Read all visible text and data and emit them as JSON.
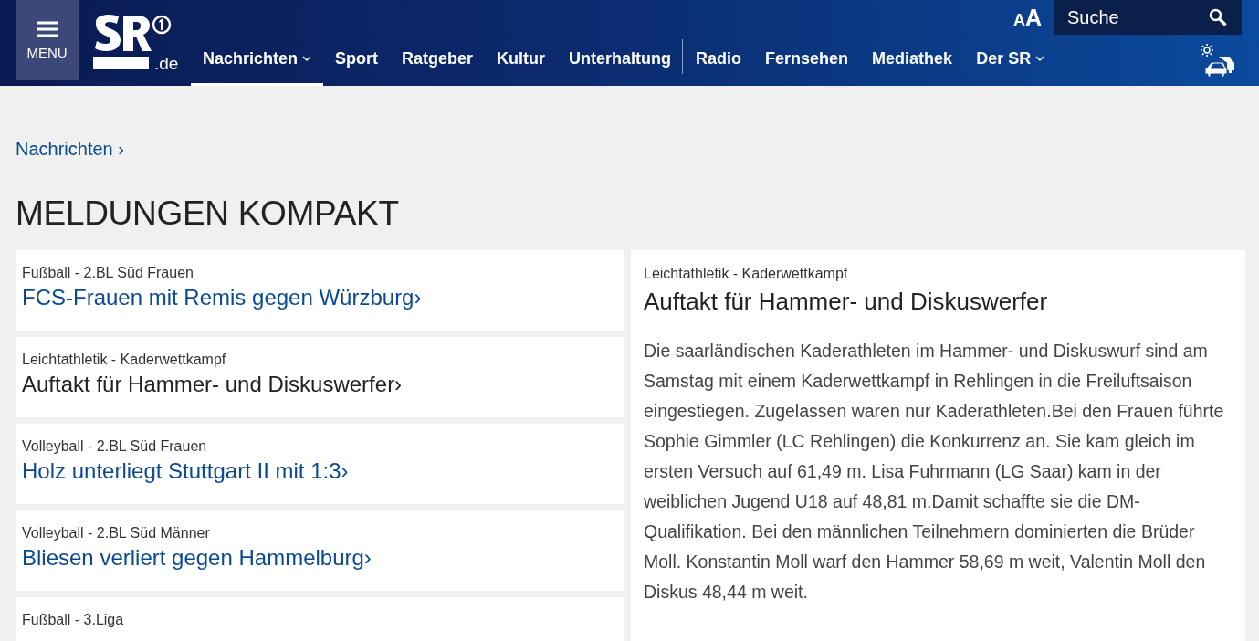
{
  "header": {
    "menu_label": "MENU",
    "logo_suffix": ".de",
    "font_size_small": "A",
    "font_size_large": "A",
    "search": {
      "placeholder": "Suche"
    },
    "nav": [
      {
        "label": "Nachrichten",
        "selected": true,
        "dropdown": true,
        "divider_after": false
      },
      {
        "label": "Sport",
        "selected": false,
        "dropdown": false,
        "divider_after": false
      },
      {
        "label": "Ratgeber",
        "selected": false,
        "dropdown": false,
        "divider_after": false
      },
      {
        "label": "Kultur",
        "selected": false,
        "dropdown": false,
        "divider_after": false
      },
      {
        "label": "Unterhaltung",
        "selected": false,
        "dropdown": false,
        "divider_after": true
      },
      {
        "label": "Radio",
        "selected": false,
        "dropdown": false,
        "divider_after": false
      },
      {
        "label": "Fernsehen",
        "selected": false,
        "dropdown": false,
        "divider_after": false
      },
      {
        "label": "Mediathek",
        "selected": false,
        "dropdown": false,
        "divider_after": false
      },
      {
        "label": "Der SR",
        "selected": false,
        "dropdown": true,
        "divider_after": false
      }
    ]
  },
  "breadcrumb": "Nachrichten ›",
  "page_title": "MELDUNGEN KOMPAKT",
  "news": [
    {
      "category": "Fußball - 2.BL Süd Frauen",
      "headline": "FCS-Frauen mit Remis gegen Würzburg›",
      "selected": false
    },
    {
      "category": "Leichtathletik - Kaderwettkampf",
      "headline": "Auftakt für Hammer- und Diskuswerfer›",
      "selected": true
    },
    {
      "category": "Volleyball - 2.BL Süd Frauen",
      "headline": "Holz unterliegt Stuttgart II mit 1:3›",
      "selected": false
    },
    {
      "category": "Volleyball - 2.BL Süd Männer",
      "headline": "Bliesen verliert gegen Hammelburg›",
      "selected": false
    },
    {
      "category": "Fußball - 3.Liga"
    }
  ],
  "detail": {
    "category": "Leichtathletik - Kaderwettkampf",
    "headline": "Auftakt für Hammer- und Diskuswerfer",
    "body": "Die saarländischen Kaderathleten im Hammer- und Diskuswurf sind am Samstag mit einem Kaderwettkampf in Rehlingen in die Freiluftsaison eingestiegen. Zugelassen waren nur Kaderathleten.Bei den Frauen führte Sophie Gimmler (LC Rehlingen) die Konkurrenz an. Sie kam gleich im ersten Versuch auf 61,49 m. Lisa Fuhrmann (LG Saar) kam in der weiblichen Jugend U18 auf 48,81 m.Damit schaffte sie die DM-Qualifikation. Bei den männlichen Teilnehmern dominierten die Brüder Moll. Konstantin Moll warf den Hammer 58,69 m weit, Valentin Moll den Diskus 48,44 m weit."
  }
}
